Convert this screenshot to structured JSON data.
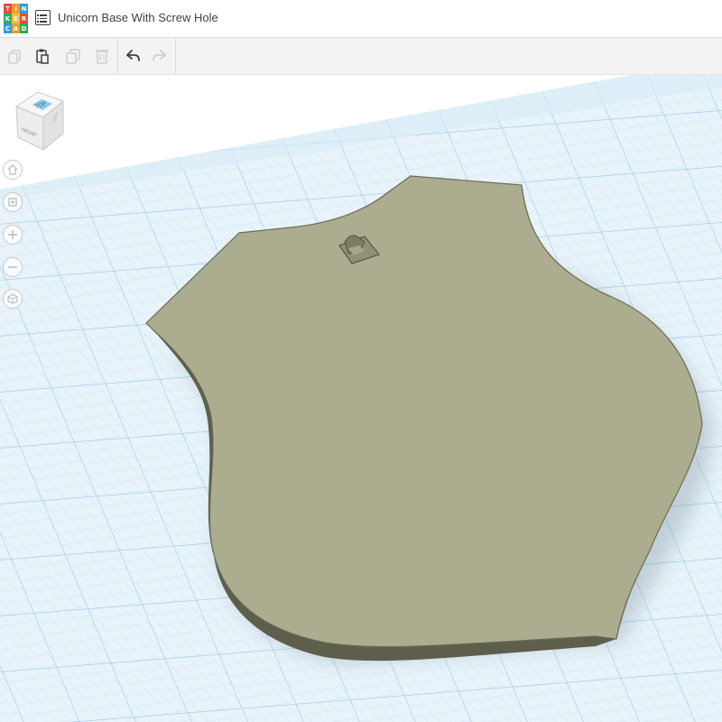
{
  "app": {
    "logo_letters": [
      "T",
      "I",
      "N",
      "K",
      "E",
      "R",
      "C",
      "A",
      "D"
    ],
    "title": "Unicorn Base With Screw Hole"
  },
  "toolbar": {
    "tools": [
      {
        "name": "copy",
        "icon": "copy-icon",
        "enabled": false
      },
      {
        "name": "paste",
        "icon": "paste-icon",
        "enabled": true
      },
      {
        "name": "duplicate",
        "icon": "duplicate-icon",
        "enabled": false
      },
      {
        "name": "delete",
        "icon": "trash-icon",
        "enabled": false
      },
      {
        "name": "undo",
        "icon": "undo-icon",
        "enabled": true
      },
      {
        "name": "redo",
        "icon": "redo-icon",
        "enabled": false
      }
    ]
  },
  "view_cube": {
    "top_label": "TOP",
    "front_label": "FRONT",
    "left_label": "LEFT"
  },
  "nav_controls": [
    "home-icon",
    "fit-view-icon",
    "zoom-in-icon",
    "zoom-out-icon",
    "orthographic-icon"
  ],
  "colors": {
    "grid_background": "#e8f3fa",
    "grid_minor": "#c6e0ef",
    "grid_major": "#93c6e3",
    "shape_top": "#acac8f",
    "shape_side": "#5d5e4b",
    "accent_cube": "#8fc9ec"
  }
}
